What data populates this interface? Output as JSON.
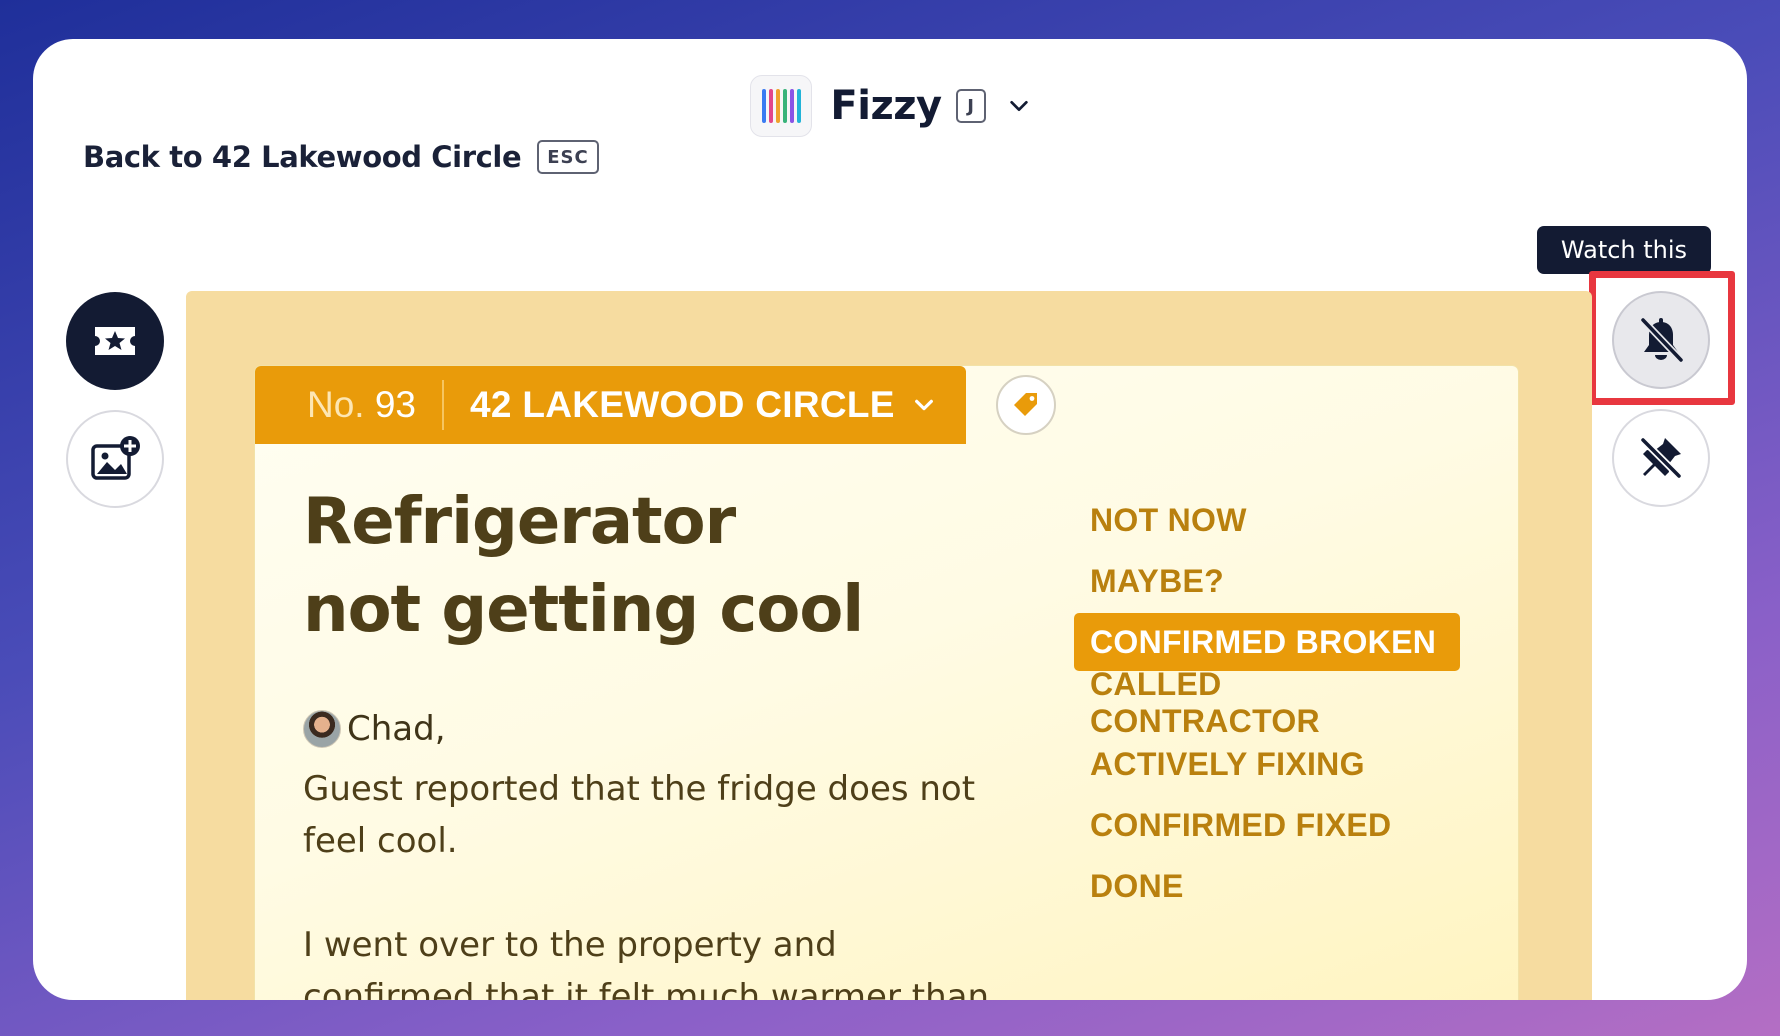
{
  "app": {
    "name": "Fizzy",
    "shortcut": "J"
  },
  "nav": {
    "back_label": "Back to 42 Lakewood Circle",
    "back_shortcut": "ESC"
  },
  "tooltip": {
    "text": "Watch this"
  },
  "card": {
    "number_prefix": "No.",
    "number": "93",
    "board": "42 LAKEWOOD CIRCLE",
    "title_line1": "Refrigerator",
    "title_line2": "not getting cool",
    "author": "Chad,",
    "paragraph1": "Guest reported that the fridge does not feel cool.",
    "paragraph2": "I went over to the property and confirmed that it felt much warmer than it should.",
    "statuses": [
      {
        "label": "NOT NOW"
      },
      {
        "label": "MAYBE?"
      },
      {
        "label": "CONFIRMED BROKEN"
      },
      {
        "label": "CALLED CONTRACTOR"
      },
      {
        "label": "ACTIVELY FIXING"
      },
      {
        "label": "CONFIRMED FIXED"
      },
      {
        "label": "DONE"
      }
    ],
    "active_status": "CONFIRMED BROKEN"
  },
  "colors": {
    "accent": "#e99b0a",
    "card_bg": "#f6dca0",
    "highlight": "#e8373f",
    "dark": "#131b33"
  },
  "icons": {
    "left_top": "ticket-star-icon",
    "left_bottom": "add-image-icon",
    "right_top": "bell-off-icon",
    "right_bottom": "pin-off-icon",
    "tag": "tag-icon"
  }
}
